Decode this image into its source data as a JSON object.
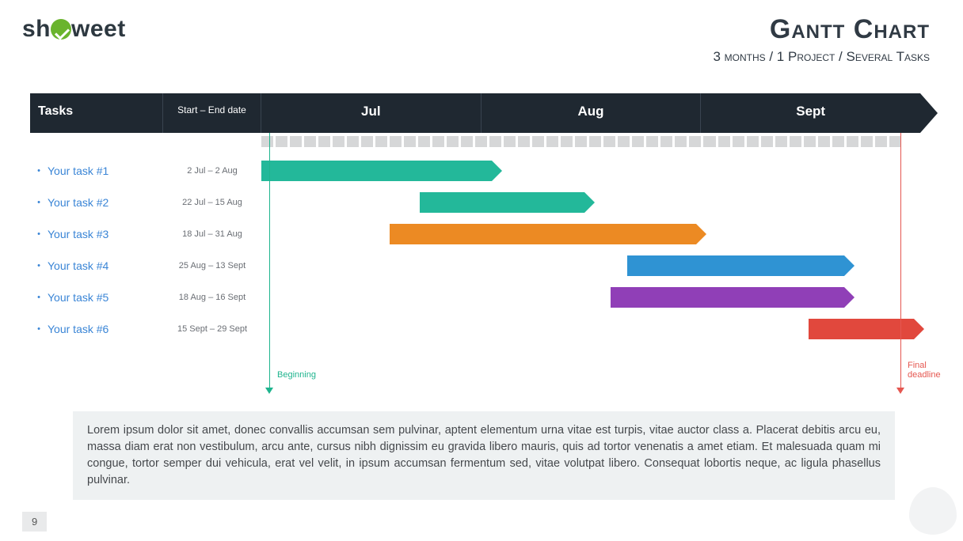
{
  "logo": {
    "pre": "sh",
    "post": "weet"
  },
  "title": "Gantt Chart",
  "subtitle": "3 months / 1 Project / Several Tasks",
  "header": {
    "col_tasks": "Tasks",
    "col_dates": "Start – End date",
    "months": [
      "Jul",
      "Aug",
      "Sept"
    ]
  },
  "tasks": [
    {
      "name": "Your task #1",
      "dates": "2 Jul – 2 Aug",
      "color": "#23b89a",
      "left_pct": 0.0,
      "width_pct": 35.0
    },
    {
      "name": "Your task #2",
      "dates": "22 Jul – 15 Aug",
      "color": "#23b89a",
      "left_pct": 24.0,
      "width_pct": 25.0
    },
    {
      "name": "Your task #3",
      "dates": "18 Jul – 31 Aug",
      "color": "#ec8a23",
      "left_pct": 19.5,
      "width_pct": 46.5
    },
    {
      "name": "Your task #4",
      "dates": "25 Aug – 13 Sept",
      "color": "#2f93d3",
      "left_pct": 55.5,
      "width_pct": 33.0
    },
    {
      "name": "Your task #5",
      "dates": "18 Aug – 16 Sept",
      "color": "#903fb7",
      "left_pct": 53.0,
      "width_pct": 35.5
    },
    {
      "name": "Your task #6",
      "dates": "15 Sept – 29 Sept",
      "color": "#e1483d",
      "left_pct": 83.0,
      "width_pct": 16.0
    }
  ],
  "markers": {
    "start": "Beginning",
    "end": "Final deadline"
  },
  "paragraph": "Lorem ipsum dolor sit amet, donec convallis accumsan sem pulvinar, aptent elementum urna vitae est turpis, vitae auctor class a. Placerat debitis arcu eu, massa diam erat non vestibulum, arcu ante, cursus nibh dignissim eu gravida libero mauris, quis ad tortor venenatis a amet etiam. Et malesuada quam mi congue, tortor semper dui vehicula, erat vel velit, in ipsum accumsan fermentum sed, vitae volutpat libero. Consequat lobortis neque, ac ligula phasellus pulvinar.",
  "page_number": "9",
  "chart_data": {
    "type": "bar",
    "orientation": "horizontal-gantt",
    "title": "Gantt Chart",
    "subtitle": "3 months / 1 Project / Several Tasks",
    "xlabel": "",
    "ylabel": "Tasks",
    "x_axis_months": [
      "Jul",
      "Aug",
      "Sept"
    ],
    "x_range_days": [
      "2 Jul",
      "29 Sept"
    ],
    "markers": [
      {
        "label": "Beginning",
        "approx_date": "2 Jul",
        "color": "#1fb48e"
      },
      {
        "label": "Final deadline",
        "approx_date": "29 Sept",
        "color": "#e55750"
      }
    ],
    "series": [
      {
        "name": "Your task #1",
        "start": "2 Jul",
        "end": "2 Aug",
        "color": "#23b89a"
      },
      {
        "name": "Your task #2",
        "start": "22 Jul",
        "end": "15 Aug",
        "color": "#23b89a"
      },
      {
        "name": "Your task #3",
        "start": "18 Jul",
        "end": "31 Aug",
        "color": "#ec8a23"
      },
      {
        "name": "Your task #4",
        "start": "25 Aug",
        "end": "13 Sept",
        "color": "#2f93d3"
      },
      {
        "name": "Your task #5",
        "start": "18 Aug",
        "end": "16 Sept",
        "color": "#903fb7"
      },
      {
        "name": "Your task #6",
        "start": "15 Sept",
        "end": "29 Sept",
        "color": "#e1483d"
      }
    ]
  }
}
